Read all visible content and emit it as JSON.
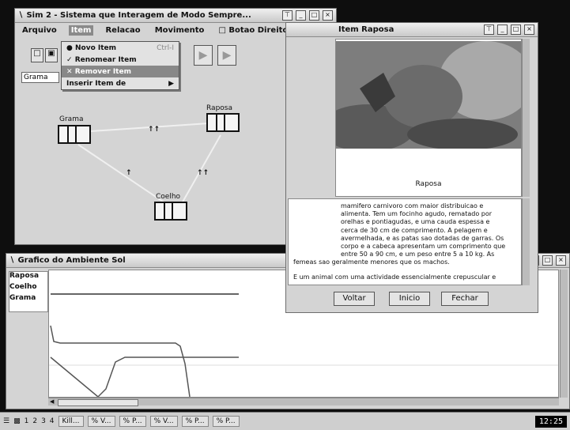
{
  "sim_window": {
    "title": "Sim 2 - Sistema que Interagem de Modo Sempre...",
    "menus": [
      "Arquivo",
      "Item",
      "Relacao",
      "Movimento",
      "Botao Direito"
    ],
    "active_menu_index": 1,
    "dropdown": [
      {
        "label": "Novo Item",
        "shortcut": "Ctrl-I",
        "icon": "radio-dot-icon"
      },
      {
        "label": "Renomear Item",
        "shortcut": "",
        "icon": "check-icon"
      },
      {
        "label": "Remover Item",
        "shortcut": "",
        "icon": "cross-icon"
      },
      {
        "label": "Inserir Item de",
        "shortcut": "▶",
        "icon": ""
      }
    ],
    "name_field_value": "Grama",
    "nodes": [
      {
        "name": "Grama"
      },
      {
        "name": "Raposa"
      },
      {
        "name": "Coelho"
      }
    ],
    "edge_labels": [
      "↑↑",
      "↑",
      "↑↑"
    ]
  },
  "info_window": {
    "title": "Item Raposa",
    "image_caption": "Raposa",
    "text_lines": [
      "mamifero carnivoro com maior distribuicao e",
      "alimenta. Tem um focinho agudo, rematado por",
      "orelhas e pontiagudas, e uma cauda espessa e",
      "cerca de 30 cm de comprimento. A pelagem e",
      "avermelhada, e as patas sao dotadas de garras. Os",
      "corpo e a cabeca apresentam um comprimento que",
      "entre 50 a 90 cm, e um peso entre 5 a 10 kg. As",
      "femeas sao geralmente menores que os machos.",
      "",
      "E um animal com uma actividade essencialmente crepuscular e"
    ],
    "buttons": {
      "back": "Voltar",
      "start": "Inicio",
      "close": "Fechar"
    }
  },
  "graph_window": {
    "title": "Grafico do Ambiente Sol",
    "legend": [
      "Raposa",
      "Coelho",
      "Grama"
    ]
  },
  "taskbar": {
    "tasks": [
      "1",
      "2",
      "3",
      "4",
      "Kill...",
      "% V...",
      "% P...",
      "% V...",
      "% P...",
      "% P..."
    ],
    "clock": "12:25"
  },
  "colors": {
    "desktop": "#0e0e0e",
    "window": "#d4d4d4",
    "highlight": "#888888"
  }
}
